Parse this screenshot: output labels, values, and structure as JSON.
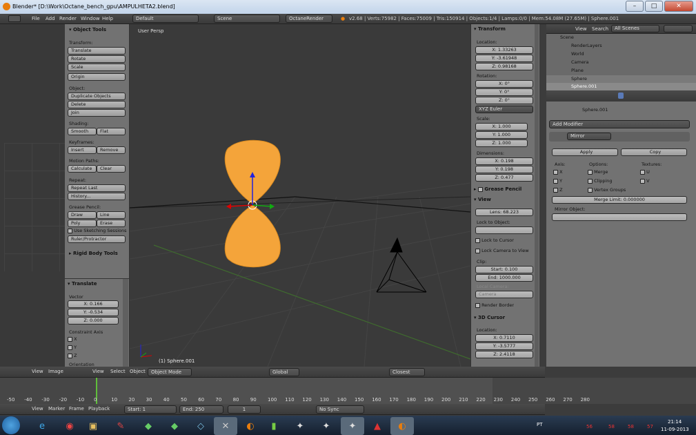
{
  "window": {
    "title": "Blender* [D:\\Work\\Octane_bench_gpu\\AMPULHETA2.blend]",
    "min": "–",
    "max": "□",
    "close": "✕"
  },
  "info_header": {
    "menus": [
      "File",
      "Add",
      "Render",
      "Window",
      "Help"
    ],
    "screen": "Default",
    "scene": "Scene",
    "engine": "OctaneRender",
    "stats": "v2.68 | Verts:75982 | Faces:75009 | Tris:150914 | Objects:1/4 | Lamps:0/0 | Mem:54.08M (27.65M) | Sphere.001"
  },
  "tool_shelf": {
    "title": "Object Tools",
    "sections": [
      {
        "label": "Transform:",
        "buttons": [
          "Translate",
          "Rotate",
          "Scale"
        ]
      },
      {
        "label": "",
        "buttons": [
          "Origin"
        ]
      },
      {
        "label": "Object:",
        "buttons": [
          "Duplicate Objects",
          "Delete",
          "Join"
        ]
      }
    ],
    "shading_label": "Shading:",
    "smooth": "Smooth",
    "flat": "Flat",
    "keyframes_label": "Keyframes:",
    "insert": "Insert",
    "remove": "Remove",
    "motion_label": "Motion Paths:",
    "calculate": "Calculate",
    "clear": "Clear",
    "repeat_label": "Repeat:",
    "repeat_last": "Repeat Last",
    "history": "History...",
    "gp_label": "Grease Pencil:",
    "draw": "Draw",
    "line": "Line",
    "poly": "Poly",
    "erase": "Erase",
    "sketch": "Use Sketching Sessions",
    "ruler": "Ruler/Protractor",
    "rigid": "Rigid Body Tools"
  },
  "operator_panel": {
    "title": "Translate",
    "vector_label": "Vector",
    "x": "X: 0.166",
    "y": "Y: -0.534",
    "z": "Z: 0.000",
    "constraint_label": "Constraint Axis",
    "axes": [
      "X",
      "Y",
      "Z"
    ],
    "orientation": "Orientation"
  },
  "viewport": {
    "view_name": "User Persp",
    "object_label": "(1) Sphere.001"
  },
  "properties_n": {
    "transform_title": "Transform",
    "location_label": "Location:",
    "loc": [
      "X: 1.33263",
      "Y: -3.61948",
      "Z: 0.98168"
    ],
    "rotation_label": "Rotation:",
    "rot": [
      "X: 0°",
      "Y: 0°",
      "Z: 0°"
    ],
    "rot_mode": "XYZ Euler",
    "scale_label": "Scale:",
    "scale": [
      "X: 1.000",
      "Y: 1.000",
      "Z: 1.000"
    ],
    "dim_label": "Dimensions:",
    "dim": [
      "X: 0.198",
      "Y: 0.198",
      "Z: 0.477"
    ],
    "grease_pencil": "Grease Pencil",
    "view_title": "View",
    "lens": "Lens: 68.223",
    "lock_obj": "Lock to Object:",
    "lock_cursor": "Lock to Cursor",
    "lock_cam": "Lock Camera to View",
    "clip_label": "Clip:",
    "clip_start": "Start: 0.100",
    "clip_end": "End: 1000.000",
    "local_cam": "Local Camera:",
    "camera": "Camera",
    "render_border": "Render Border",
    "cursor_title": "3D Cursor",
    "cursor_loc_label": "Location:",
    "cursor": [
      "X: 0.7110",
      "Y: -3.5777",
      "Z: 2.4118"
    ]
  },
  "viewport_header": {
    "view": "View",
    "select": "Select",
    "object": "Object",
    "mode": "Object Mode",
    "orient": "Global",
    "snap": "Closest"
  },
  "left_header": {
    "view": "View",
    "image": "Image"
  },
  "timeline": {
    "ticks": [
      "-50",
      "-40",
      "-30",
      "-20",
      "-10",
      "0",
      "10",
      "20",
      "30",
      "40",
      "50",
      "60",
      "70",
      "80",
      "90",
      "100",
      "110",
      "120",
      "130",
      "140",
      "150",
      "160",
      "170",
      "180",
      "190",
      "200",
      "210",
      "220",
      "230",
      "240",
      "250",
      "260",
      "270",
      "280"
    ],
    "menus": [
      "View",
      "Marker",
      "Frame",
      "Playback"
    ],
    "start": "Start: 1",
    "end": "End: 250",
    "current": "1",
    "sync": "No Sync"
  },
  "outliner": {
    "view": "View",
    "search": "Search",
    "scenes": "All Scenes",
    "items": [
      "Scene",
      "RenderLayers",
      "World",
      "Camera",
      "Plane",
      "Sphere",
      "Sphere.001"
    ]
  },
  "props_editor": {
    "object_name": "Sphere.001",
    "add_modifier": "Add Modifier",
    "modifier_name": "Mirror",
    "apply": "Apply",
    "copy": "Copy",
    "axis_label": "Axis:",
    "options_label": "Options:",
    "textures_label": "Textures:",
    "axes": [
      "X",
      "Y",
      "Z"
    ],
    "merge": "Merge",
    "clipping": "Clipping",
    "vgroups": "Vertex Groups",
    "u": "U",
    "v": "V",
    "merge_limit": "Merge Limit: 0.000000",
    "mirror_obj": "Mirror Object:"
  },
  "taskbar": {
    "lang": "PT",
    "nums": [
      "56",
      "58",
      "58",
      "57"
    ],
    "time": "21:14",
    "date": "11-09-2013"
  },
  "colors": {
    "selected": "#f5a030",
    "accent": "#e87d0d",
    "taskbar": "#1c2a3a"
  }
}
